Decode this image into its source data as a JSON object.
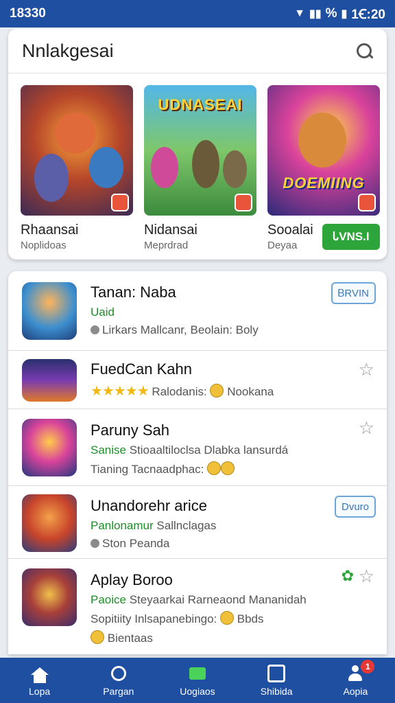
{
  "status": {
    "time_left": "18330",
    "battery": "%",
    "time_right": "1Ꞓ:20"
  },
  "header": {
    "title": "Nnlakgesai"
  },
  "featured": [
    {
      "name": "Rhaansai",
      "sub": "Noplidoas",
      "art_text": ""
    },
    {
      "name": "Nidansai",
      "sub": "Meprdrad",
      "art_text": "UDNASEAI"
    },
    {
      "name": "Sooalai",
      "sub": "Deyaa",
      "art_text": "DOEMIING",
      "button": "ᏓVNS.I"
    }
  ],
  "list": [
    {
      "title": "Tanan: Naba",
      "line1": "Uaid",
      "line2": "Lirkars Mallcanr, Beolain: Boly",
      "tag": "ᏴRVIN"
    },
    {
      "title": "FuedCan Kahn",
      "rating_stars": "★★★★★",
      "line1": "Ralodanis:",
      "line1b": "Nookana"
    },
    {
      "title": "Paruny Sah",
      "line1_green": "Sanise",
      "line1": "Stioaaltiloclsa Dlabka lansurdá",
      "line2": "Tianing Tacnaadphac:"
    },
    {
      "title": "Unandorehr arice",
      "line1_green": "Panlonamur",
      "line1": "Sallnclagas",
      "line2": "Ston Peanda",
      "tag": "Dvuro"
    },
    {
      "title": "Aplay Boroo",
      "line1_green": "Paoice",
      "line1": "Steyaarkai Rarneaond Mananidah",
      "line2": "Sopitiity Inlsapanebingo:",
      "line2b": "Bbds",
      "line3": "Bientaas"
    }
  ],
  "nav": [
    {
      "label": "Lopa"
    },
    {
      "label": "Pargan"
    },
    {
      "label": "Uogiaos"
    },
    {
      "label": "Shibida"
    },
    {
      "label": "Aopia",
      "badge": "1"
    }
  ]
}
